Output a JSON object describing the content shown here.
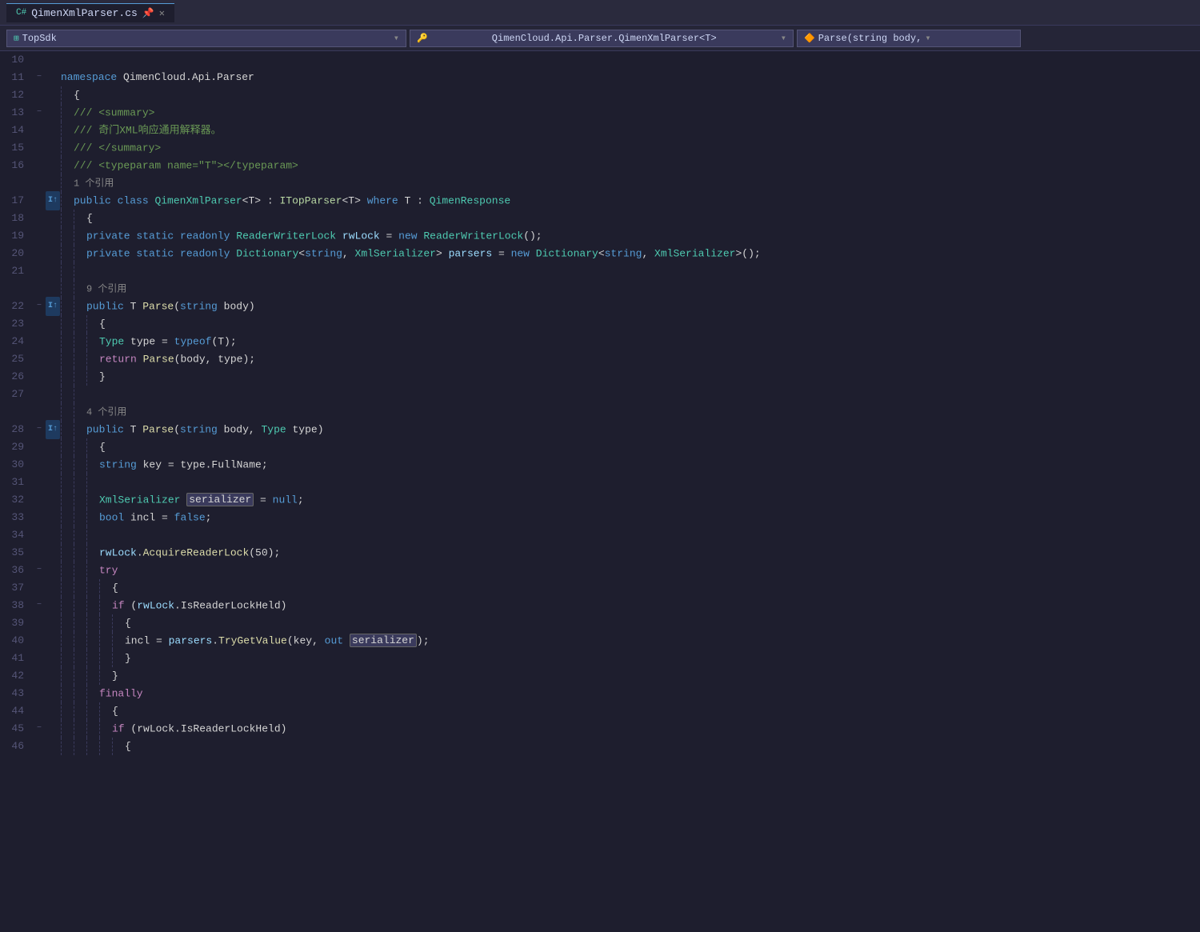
{
  "titleBar": {
    "filename": "QimenXmlParser.cs",
    "pinLabel": "📌",
    "closeLabel": "✕"
  },
  "navBar": {
    "leftDropdown": "⊞ TopSdk",
    "middleDropdown": "QimenCloud.Api.Parser.QimenXmlParser<T>",
    "rightDropdown": "Parse(string body,"
  },
  "lines": [
    {
      "num": "10",
      "indent": 0,
      "fold": "",
      "indicator": "",
      "tokens": []
    },
    {
      "num": "11",
      "indent": 0,
      "fold": "−",
      "indicator": "",
      "tokens": [
        {
          "t": "namespace-kw",
          "v": "namespace"
        },
        {
          "t": "plain",
          "v": " QimenCloud.Api.Parser"
        }
      ]
    },
    {
      "num": "12",
      "indent": 1,
      "fold": "",
      "indicator": "",
      "tokens": [
        {
          "t": "plain",
          "v": "{"
        }
      ]
    },
    {
      "num": "13",
      "indent": 1,
      "fold": "−",
      "indicator": "",
      "tokens": [
        {
          "t": "comment",
          "v": "/// <summary>"
        }
      ]
    },
    {
      "num": "14",
      "indent": 1,
      "fold": "",
      "indicator": "",
      "tokens": [
        {
          "t": "comment",
          "v": "/// 奇门XML响应通用解释器。"
        }
      ]
    },
    {
      "num": "15",
      "indent": 1,
      "fold": "",
      "indicator": "",
      "tokens": [
        {
          "t": "comment",
          "v": "/// </summary>"
        }
      ]
    },
    {
      "num": "16",
      "indent": 1,
      "fold": "",
      "indicator": "",
      "tokens": [
        {
          "t": "comment",
          "v": "/// <typeparam name=\"T\"></typeparam>"
        }
      ]
    },
    {
      "num": "",
      "indent": 1,
      "fold": "",
      "indicator": "",
      "tokens": [
        {
          "t": "ref-count",
          "v": "1 个引用"
        }
      ]
    },
    {
      "num": "17",
      "indent": 1,
      "fold": "",
      "indicator": "bp",
      "tokens": [
        {
          "t": "kw",
          "v": "public"
        },
        {
          "t": "plain",
          "v": " "
        },
        {
          "t": "kw",
          "v": "class"
        },
        {
          "t": "plain",
          "v": " "
        },
        {
          "t": "type",
          "v": "QimenXmlParser"
        },
        {
          "t": "plain",
          "v": "<T> : "
        },
        {
          "t": "interface-color",
          "v": "ITopParser"
        },
        {
          "t": "plain",
          "v": "<T> "
        },
        {
          "t": "where-kw",
          "v": "where"
        },
        {
          "t": "plain",
          "v": " T : "
        },
        {
          "t": "type",
          "v": "QimenResponse"
        }
      ]
    },
    {
      "num": "18",
      "indent": 2,
      "fold": "",
      "indicator": "",
      "tokens": [
        {
          "t": "plain",
          "v": "{"
        }
      ]
    },
    {
      "num": "19",
      "indent": 2,
      "fold": "",
      "indicator": "",
      "tokens": [
        {
          "t": "kw",
          "v": "private"
        },
        {
          "t": "plain",
          "v": " "
        },
        {
          "t": "kw",
          "v": "static"
        },
        {
          "t": "plain",
          "v": " "
        },
        {
          "t": "kw",
          "v": "readonly"
        },
        {
          "t": "plain",
          "v": " "
        },
        {
          "t": "type",
          "v": "ReaderWriterLock"
        },
        {
          "t": "plain",
          "v": " "
        },
        {
          "t": "param",
          "v": "rwLock"
        },
        {
          "t": "plain",
          "v": " = "
        },
        {
          "t": "kw",
          "v": "new"
        },
        {
          "t": "plain",
          "v": " "
        },
        {
          "t": "type",
          "v": "ReaderWriterLock"
        },
        {
          "t": "plain",
          "v": "();"
        }
      ]
    },
    {
      "num": "20",
      "indent": 2,
      "fold": "",
      "indicator": "",
      "tokens": [
        {
          "t": "kw",
          "v": "private"
        },
        {
          "t": "plain",
          "v": " "
        },
        {
          "t": "kw",
          "v": "static"
        },
        {
          "t": "plain",
          "v": " "
        },
        {
          "t": "kw",
          "v": "readonly"
        },
        {
          "t": "plain",
          "v": " "
        },
        {
          "t": "type",
          "v": "Dictionary"
        },
        {
          "t": "plain",
          "v": "<"
        },
        {
          "t": "kw",
          "v": "string"
        },
        {
          "t": "plain",
          "v": ", "
        },
        {
          "t": "type",
          "v": "XmlSerializer"
        },
        {
          "t": "plain",
          "v": "> "
        },
        {
          "t": "param",
          "v": "parsers"
        },
        {
          "t": "plain",
          "v": " = "
        },
        {
          "t": "kw",
          "v": "new"
        },
        {
          "t": "plain",
          "v": " "
        },
        {
          "t": "type",
          "v": "Dictionary"
        },
        {
          "t": "plain",
          "v": "<"
        },
        {
          "t": "kw",
          "v": "string"
        },
        {
          "t": "plain",
          "v": ", "
        },
        {
          "t": "type",
          "v": "XmlSerializer"
        },
        {
          "t": "plain",
          "v": ">();"
        }
      ]
    },
    {
      "num": "21",
      "indent": 2,
      "fold": "",
      "indicator": "",
      "tokens": []
    },
    {
      "num": "",
      "indent": 2,
      "fold": "",
      "indicator": "",
      "tokens": [
        {
          "t": "ref-count",
          "v": "9 个引用"
        }
      ]
    },
    {
      "num": "22",
      "indent": 2,
      "fold": "−",
      "indicator": "bp",
      "tokens": [
        {
          "t": "kw",
          "v": "public"
        },
        {
          "t": "plain",
          "v": " T "
        },
        {
          "t": "method",
          "v": "Parse"
        },
        {
          "t": "plain",
          "v": "("
        },
        {
          "t": "kw",
          "v": "string"
        },
        {
          "t": "plain",
          "v": " body)"
        }
      ]
    },
    {
      "num": "23",
      "indent": 3,
      "fold": "",
      "indicator": "",
      "tokens": [
        {
          "t": "plain",
          "v": "{"
        }
      ]
    },
    {
      "num": "24",
      "indent": 3,
      "fold": "",
      "indicator": "",
      "tokens": [
        {
          "t": "type",
          "v": "Type"
        },
        {
          "t": "plain",
          "v": " type = "
        },
        {
          "t": "kw",
          "v": "typeof"
        },
        {
          "t": "plain",
          "v": "(T);"
        }
      ]
    },
    {
      "num": "25",
      "indent": 3,
      "fold": "",
      "indicator": "",
      "tokens": [
        {
          "t": "kw-ctrl",
          "v": "return"
        },
        {
          "t": "plain",
          "v": " "
        },
        {
          "t": "method",
          "v": "Parse"
        },
        {
          "t": "plain",
          "v": "(body, type);"
        }
      ]
    },
    {
      "num": "26",
      "indent": 3,
      "fold": "",
      "indicator": "",
      "tokens": [
        {
          "t": "plain",
          "v": "}"
        }
      ]
    },
    {
      "num": "27",
      "indent": 2,
      "fold": "",
      "indicator": "",
      "tokens": []
    },
    {
      "num": "",
      "indent": 2,
      "fold": "",
      "indicator": "",
      "tokens": [
        {
          "t": "ref-count",
          "v": "4 个引用"
        }
      ]
    },
    {
      "num": "28",
      "indent": 2,
      "fold": "−",
      "indicator": "bp",
      "tokens": [
        {
          "t": "kw",
          "v": "public"
        },
        {
          "t": "plain",
          "v": " T "
        },
        {
          "t": "method",
          "v": "Parse"
        },
        {
          "t": "plain",
          "v": "("
        },
        {
          "t": "kw",
          "v": "string"
        },
        {
          "t": "plain",
          "v": " body, "
        },
        {
          "t": "type",
          "v": "Type"
        },
        {
          "t": "plain",
          "v": " type)"
        }
      ]
    },
    {
      "num": "29",
      "indent": 3,
      "fold": "",
      "indicator": "",
      "tokens": [
        {
          "t": "plain",
          "v": "{"
        }
      ]
    },
    {
      "num": "30",
      "indent": 3,
      "fold": "",
      "indicator": "",
      "tokens": [
        {
          "t": "kw",
          "v": "string"
        },
        {
          "t": "plain",
          "v": " key = type.FullName;"
        }
      ]
    },
    {
      "num": "31",
      "indent": 3,
      "fold": "",
      "indicator": "",
      "tokens": []
    },
    {
      "num": "32",
      "indent": 3,
      "fold": "",
      "indicator": "",
      "tokens": [
        {
          "t": "type",
          "v": "XmlSerializer"
        },
        {
          "t": "plain",
          "v": " "
        },
        {
          "t": "highlight",
          "v": "serializer"
        },
        {
          "t": "plain",
          "v": " = "
        },
        {
          "t": "kw",
          "v": "null"
        },
        {
          "t": "plain",
          "v": ";"
        }
      ]
    },
    {
      "num": "33",
      "indent": 3,
      "fold": "",
      "indicator": "",
      "tokens": [
        {
          "t": "kw",
          "v": "bool"
        },
        {
          "t": "plain",
          "v": " incl = "
        },
        {
          "t": "kw",
          "v": "false"
        },
        {
          "t": "plain",
          "v": ";"
        }
      ]
    },
    {
      "num": "34",
      "indent": 3,
      "fold": "",
      "indicator": "",
      "tokens": []
    },
    {
      "num": "35",
      "indent": 3,
      "fold": "",
      "indicator": "",
      "tokens": [
        {
          "t": "param",
          "v": "rwLock"
        },
        {
          "t": "plain",
          "v": "."
        },
        {
          "t": "method",
          "v": "AcquireReaderLock"
        },
        {
          "t": "plain",
          "v": "(50);"
        }
      ]
    },
    {
      "num": "36",
      "indent": 3,
      "fold": "−",
      "indicator": "",
      "tokens": [
        {
          "t": "kw-ctrl",
          "v": "try"
        }
      ]
    },
    {
      "num": "37",
      "indent": 4,
      "fold": "",
      "indicator": "",
      "tokens": [
        {
          "t": "plain",
          "v": "{"
        }
      ]
    },
    {
      "num": "38",
      "indent": 4,
      "fold": "−",
      "indicator": "",
      "tokens": [
        {
          "t": "kw-ctrl",
          "v": "if"
        },
        {
          "t": "plain",
          "v": " ("
        },
        {
          "t": "param",
          "v": "rwLock"
        },
        {
          "t": "plain",
          "v": ".IsReaderLockHeld)"
        }
      ]
    },
    {
      "num": "39",
      "indent": 5,
      "fold": "",
      "indicator": "",
      "tokens": [
        {
          "t": "plain",
          "v": "{"
        }
      ]
    },
    {
      "num": "40",
      "indent": 5,
      "fold": "",
      "indicator": "",
      "tokens": [
        {
          "t": "plain",
          "v": "incl = "
        },
        {
          "t": "param",
          "v": "parsers"
        },
        {
          "t": "plain",
          "v": "."
        },
        {
          "t": "method",
          "v": "TryGetValue"
        },
        {
          "t": "plain",
          "v": "(key, "
        },
        {
          "t": "kw",
          "v": "out"
        },
        {
          "t": "plain",
          "v": " "
        },
        {
          "t": "highlight",
          "v": "serializer"
        },
        {
          "t": "plain",
          "v": ");"
        }
      ]
    },
    {
      "num": "41",
      "indent": 5,
      "fold": "",
      "indicator": "",
      "tokens": [
        {
          "t": "plain",
          "v": "}"
        }
      ]
    },
    {
      "num": "42",
      "indent": 4,
      "fold": "",
      "indicator": "",
      "tokens": [
        {
          "t": "plain",
          "v": "}"
        }
      ]
    },
    {
      "num": "43",
      "indent": 3,
      "fold": "",
      "indicator": "",
      "tokens": [
        {
          "t": "kw-ctrl",
          "v": "finally"
        }
      ]
    },
    {
      "num": "44",
      "indent": 4,
      "fold": "",
      "indicator": "",
      "tokens": [
        {
          "t": "plain",
          "v": "{"
        }
      ]
    },
    {
      "num": "45",
      "indent": 4,
      "fold": "−",
      "indicator": "",
      "tokens": [
        {
          "t": "kw-ctrl",
          "v": "if"
        },
        {
          "t": "plain",
          "v": " (rwLock.IsReaderLockHeld)"
        }
      ]
    },
    {
      "num": "46",
      "indent": 5,
      "fold": "",
      "indicator": "",
      "tokens": [
        {
          "t": "plain",
          "v": "{"
        }
      ]
    }
  ]
}
